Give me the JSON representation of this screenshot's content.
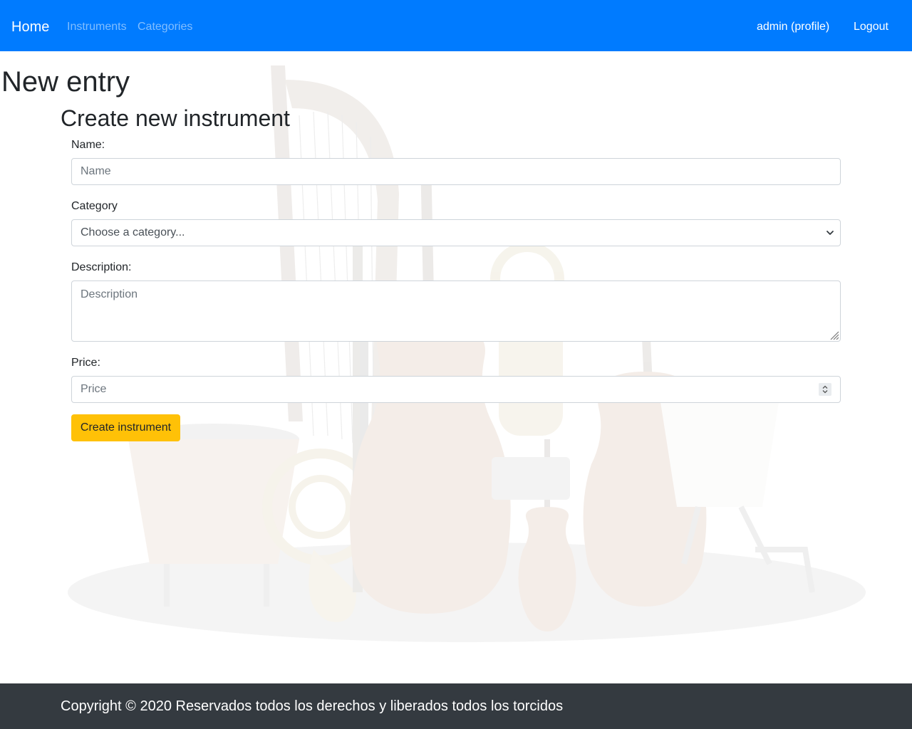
{
  "navbar": {
    "brand": "Home",
    "links": [
      {
        "label": "Instruments"
      },
      {
        "label": "Categories"
      }
    ],
    "right_links": [
      {
        "label": "admin (profile)"
      },
      {
        "label": "Logout"
      }
    ],
    "colors": {
      "background": "#007bff",
      "muted_link": "rgba(255,255,255,0.5)"
    }
  },
  "page": {
    "title": "New entry",
    "form_title": "Create new instrument"
  },
  "form": {
    "name_label": "Name:",
    "name_placeholder": "Name",
    "name_value": "",
    "category_label": "Category",
    "category_selected": "Choose a category...",
    "description_label": "Description:",
    "description_placeholder": "Description",
    "description_value": "",
    "price_label": "Price:",
    "price_placeholder": "Price",
    "price_value": "",
    "submit_label": "Create instrument",
    "submit_color": "#ffc107"
  },
  "background": {
    "icon": "orchestra-instruments-illustration"
  },
  "footer": {
    "text": "Copyright © 2020 Reservados todos los derechos y liberados todos los torcidos",
    "background": "#343a40"
  }
}
